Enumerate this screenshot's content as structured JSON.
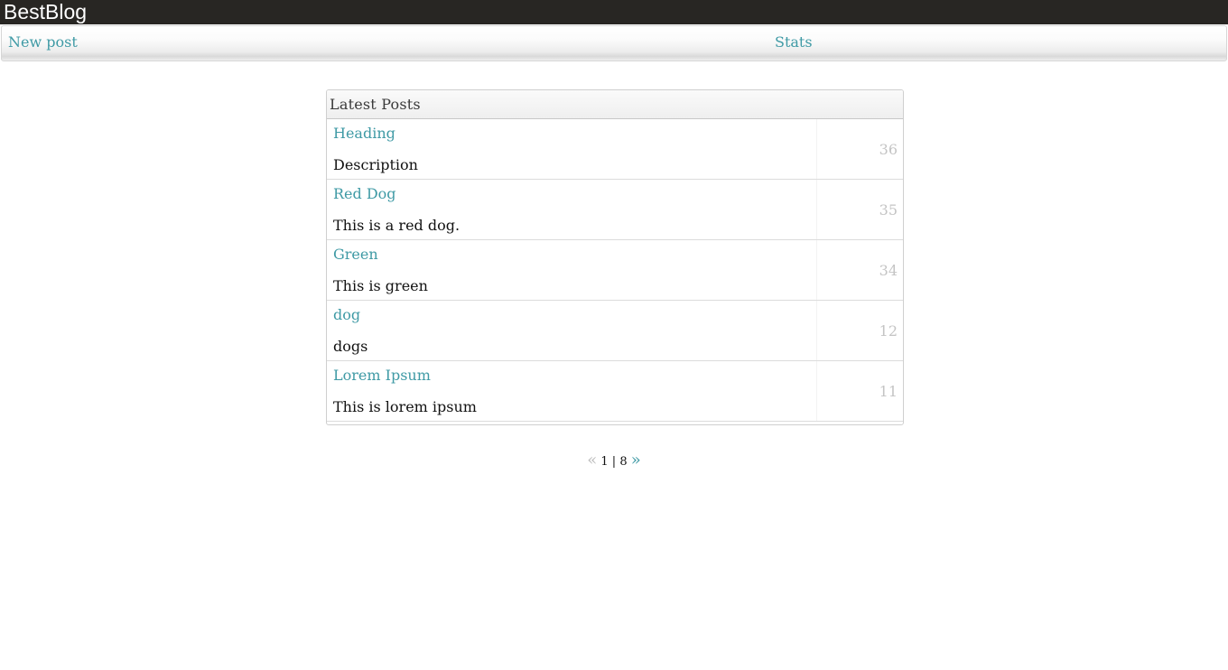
{
  "app": {
    "title": "BestBlog"
  },
  "nav": {
    "new_post": "New post",
    "stats": "Stats"
  },
  "panel": {
    "title": "Latest Posts",
    "posts": [
      {
        "title": "Heading",
        "description": "Description",
        "count": "36"
      },
      {
        "title": "Red Dog",
        "description": "This is a red dog.",
        "count": "35"
      },
      {
        "title": "Green",
        "description": "This is green",
        "count": "34"
      },
      {
        "title": "dog",
        "description": "dogs",
        "count": "12"
      },
      {
        "title": "Lorem Ipsum",
        "description": "This is lorem ipsum",
        "count": "11"
      }
    ]
  },
  "pager": {
    "prev": "«",
    "current": "1",
    "separator": "|",
    "total": "8",
    "next": "»"
  },
  "colors": {
    "topbar": "#282623",
    "link": "#3f9aa5",
    "count": "#c4c4c4"
  }
}
